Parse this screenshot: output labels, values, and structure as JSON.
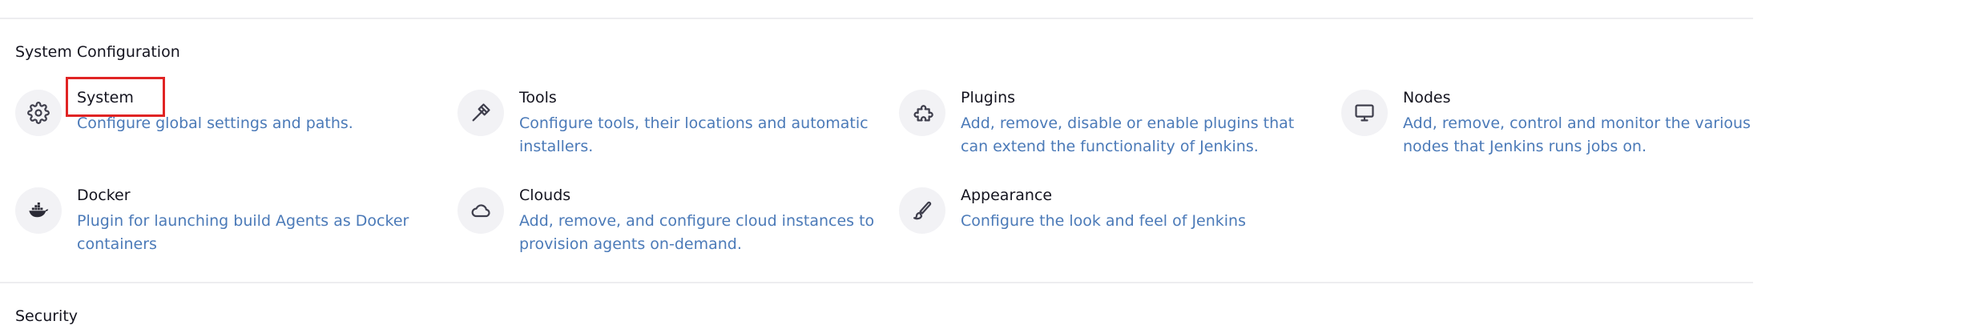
{
  "sections": [
    {
      "title": "System Configuration",
      "items": [
        {
          "name": "System",
          "description": "Configure global settings and paths.",
          "icon": "gear-icon"
        },
        {
          "name": "Tools",
          "description": "Configure tools, their locations and automatic installers.",
          "icon": "hammer-icon"
        },
        {
          "name": "Plugins",
          "description": "Add, remove, disable or enable plugins that can extend the functionality of Jenkins.",
          "icon": "puzzle-icon"
        },
        {
          "name": "Nodes",
          "description": "Add, remove, control and monitor the various nodes that Jenkins runs jobs on.",
          "icon": "monitor-icon"
        },
        {
          "name": "Docker",
          "description": "Plugin for launching build Agents as Docker containers",
          "icon": "docker-icon"
        },
        {
          "name": "Clouds",
          "description": "Add, remove, and configure cloud instances to provision agents on-demand.",
          "icon": "cloud-icon"
        },
        {
          "name": "Appearance",
          "description": "Configure the look and feel of Jenkins",
          "icon": "paintbrush-icon"
        }
      ]
    },
    {
      "title": "Security",
      "items": []
    }
  ],
  "highlight": {
    "target": "System",
    "color": "#e02424"
  },
  "colors": {
    "description_link": "#4b7ab8",
    "icon_background": "#f2f2f5",
    "divider": "#ededf0"
  }
}
